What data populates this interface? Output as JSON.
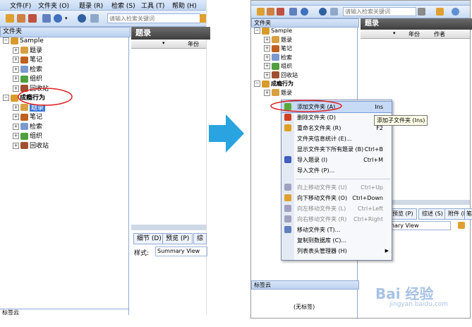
{
  "left": {
    "menu": [
      "文件(F)",
      "文件夹 (O)",
      "题录 (R)",
      "检索 (S)",
      "工具 (T)",
      "帮助 (H)"
    ],
    "search_placeholder": "请输入检索关键词",
    "folder_pane_title": "文件夹",
    "tree": [
      {
        "label": "Sample",
        "indent": 0,
        "bold": false,
        "color": "#d89a2a"
      },
      {
        "label": "题录",
        "indent": 1,
        "bold": false,
        "color": "#d8a040"
      },
      {
        "label": "笔记",
        "indent": 1,
        "bold": false,
        "color": "#c06020"
      },
      {
        "label": "检索",
        "indent": 1,
        "bold": false,
        "color": "#7a9ad0"
      },
      {
        "label": "组织",
        "indent": 1,
        "bold": false,
        "color": "#50a040"
      },
      {
        "label": "回收站",
        "indent": 1,
        "bold": false,
        "color": "#a05030"
      },
      {
        "label": "成瘾行为",
        "indent": 0,
        "bold": true,
        "color": "#d89a2a"
      },
      {
        "label": "题录",
        "indent": 1,
        "bold": false,
        "selected": true,
        "color": "#d8a040"
      },
      {
        "label": "笔记",
        "indent": 1,
        "bold": false,
        "color": "#c06020"
      },
      {
        "label": "检索",
        "indent": 1,
        "bold": false,
        "color": "#7a9ad0"
      },
      {
        "label": "组织",
        "indent": 1,
        "bold": false,
        "color": "#50a040"
      },
      {
        "label": "回收站",
        "indent": 1,
        "bold": false,
        "color": "#a05030"
      }
    ],
    "records_title": "题录",
    "col_year": "年份",
    "tabs": [
      "细节 (D)",
      "预览 (P)",
      "综"
    ],
    "style_label": "样式:",
    "style_value": "Summary View",
    "tagcloud_title": "标签云"
  },
  "right": {
    "search_placeholder": "请输入检索关键词",
    "folder_pane_title": "文件夹",
    "tree": [
      {
        "label": "Sample",
        "indent": 0,
        "bold": false,
        "color": "#d89a2a"
      },
      {
        "label": "题录",
        "indent": 1,
        "bold": false,
        "color": "#d8a040"
      },
      {
        "label": "笔记",
        "indent": 1,
        "bold": false,
        "color": "#c06020"
      },
      {
        "label": "检索",
        "indent": 1,
        "bold": false,
        "color": "#7a9ad0"
      },
      {
        "label": "组织",
        "indent": 1,
        "bold": false,
        "color": "#50a040"
      },
      {
        "label": "回收站",
        "indent": 1,
        "bold": false,
        "color": "#a05030"
      },
      {
        "label": "成瘾行为",
        "indent": 0,
        "bold": true,
        "color": "#d89a2a"
      },
      {
        "label": "题录",
        "indent": 1,
        "bold": false,
        "color": "#d8a040"
      }
    ],
    "records_title": "题录",
    "col_year": "年份",
    "col_author": "作者",
    "tabs": [
      "预览 (P)",
      "综述 (S)",
      "附件 (K)",
      "笔"
    ],
    "style_value": "nary View",
    "tagcloud_title": "标签云",
    "tagcloud_empty": "(无标签)",
    "tooltip": "添加子文件夹 (Ins)",
    "context_menu": [
      {
        "label": "添加文件夹 (A)",
        "shortcut": "Ins",
        "enabled": true,
        "highlight": true,
        "icon": "#5aa83a"
      },
      {
        "label": "删除文件夹 (D)",
        "shortcut": "Del",
        "enabled": true,
        "icon": "#d04020"
      },
      {
        "label": "重命名文件夹 (R)",
        "shortcut": "F2",
        "enabled": true,
        "icon": "#e0a020"
      },
      {
        "label": "文件夹信息统计 (E)...",
        "shortcut": "",
        "enabled": true,
        "icon": ""
      },
      {
        "label": "显示文件夹下所有题录 (B)",
        "shortcut": "Ctrl+B",
        "enabled": true,
        "icon": ""
      },
      {
        "label": "导入题录 (I)",
        "shortcut": "Ctrl+M",
        "enabled": true,
        "icon": "#4060c0"
      },
      {
        "label": "导入文件 (P)...",
        "shortcut": "",
        "enabled": true,
        "icon": ""
      },
      {
        "separator": true
      },
      {
        "label": "向上移动文件夹 (U)",
        "shortcut": "Ctrl+Up",
        "enabled": false,
        "icon": "#a0a0c0"
      },
      {
        "label": "向下移动文件夹 (O)",
        "shortcut": "Ctrl+Down",
        "enabled": true,
        "icon": "#e0a030"
      },
      {
        "label": "向左移动文件夹 (L)",
        "shortcut": "Ctrl+Left",
        "enabled": false,
        "icon": "#a0a0c0"
      },
      {
        "label": "向右移动文件夹 (R)",
        "shortcut": "Ctrl+Right",
        "enabled": false,
        "icon": "#a0a0c0"
      },
      {
        "label": "移动文件夹 (T)...",
        "shortcut": "",
        "enabled": true,
        "icon": "#6080c0"
      },
      {
        "label": "复制到数据库 (C)...",
        "shortcut": "",
        "enabled": true,
        "icon": ""
      },
      {
        "label": "列表表头管理器 (H)",
        "shortcut": "",
        "enabled": true,
        "icon": "",
        "submenu": true
      }
    ]
  },
  "watermark": "Bai 经验",
  "watermark_url": "jingyan.baidu.com",
  "colors": {
    "arrow": "#2aa4e0",
    "highlight_circle": "#e02020",
    "menu_highlight": "#c6d9f5"
  }
}
